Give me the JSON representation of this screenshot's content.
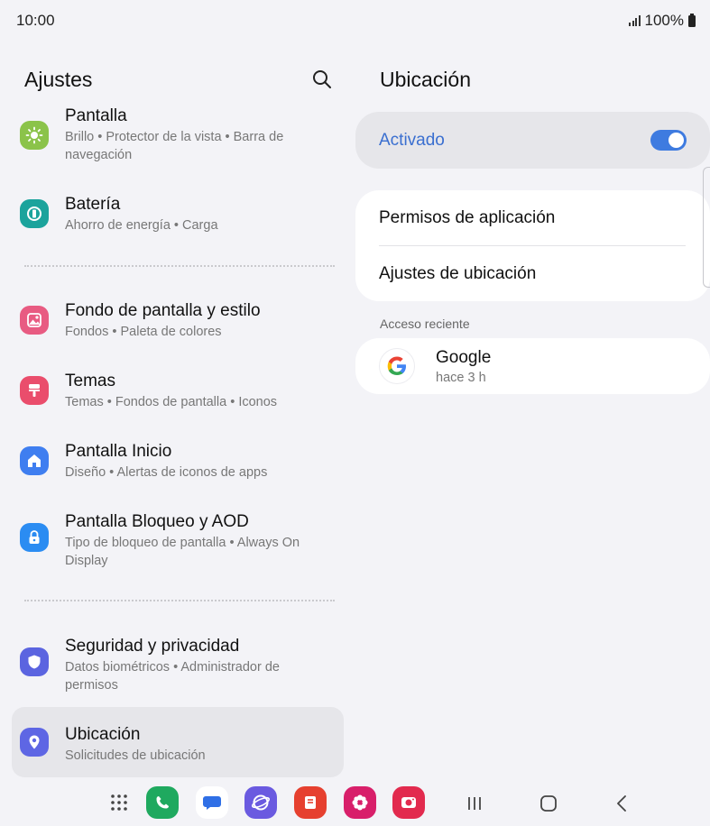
{
  "status": {
    "time": "10:00",
    "battery": "100%"
  },
  "left": {
    "title": "Ajustes",
    "items": [
      {
        "title": "Pantalla",
        "subtitle": "Brillo  •  Protector de la vista  •  Barra de navegación",
        "icon": "sun-icon",
        "color": "#8bc34a"
      },
      {
        "title": "Batería",
        "subtitle": "Ahorro de energía  •  Carga",
        "icon": "battery-icon",
        "color": "#1ba39c"
      },
      {
        "title": "Fondo de pantalla y estilo",
        "subtitle": "Fondos  •  Paleta de colores",
        "icon": "wallpaper-icon",
        "color": "#e85b82"
      },
      {
        "title": "Temas",
        "subtitle": "Temas  •  Fondos de pantalla  •  Iconos",
        "icon": "brush-icon",
        "color": "#ea4d6c"
      },
      {
        "title": "Pantalla Inicio",
        "subtitle": "Diseño  •  Alertas de iconos de apps",
        "icon": "home-icon",
        "color": "#3f7ef0"
      },
      {
        "title": "Pantalla Bloqueo y AOD",
        "subtitle": "Tipo de bloqueo de pantalla  •  Always On Display",
        "icon": "lock-icon",
        "color": "#2b8cf2"
      },
      {
        "title": "Seguridad y privacidad",
        "subtitle": "Datos biométricos  •  Administrador de permisos",
        "icon": "shield-icon",
        "color": "#5b64e0"
      },
      {
        "title": "Ubicación",
        "subtitle": "Solicitudes de ubicación",
        "icon": "location-pin-icon",
        "color": "#5e66e4"
      }
    ]
  },
  "right": {
    "title": "Ubicación",
    "toggle": {
      "label": "Activado",
      "on": true,
      "accent": "#3e7be0"
    },
    "menu": [
      "Permisos de aplicación",
      "Ajustes de ubicación"
    ],
    "recent_label": "Acceso reciente",
    "recent": [
      {
        "app": "Google",
        "time": "hace 3 h"
      }
    ]
  },
  "dock": [
    "apps-grid-icon",
    "phone-icon",
    "messages-icon",
    "internet-icon",
    "notes-icon",
    "gallery-icon",
    "camera-icon"
  ],
  "nav": [
    "recents-icon",
    "home-icon",
    "back-icon"
  ]
}
